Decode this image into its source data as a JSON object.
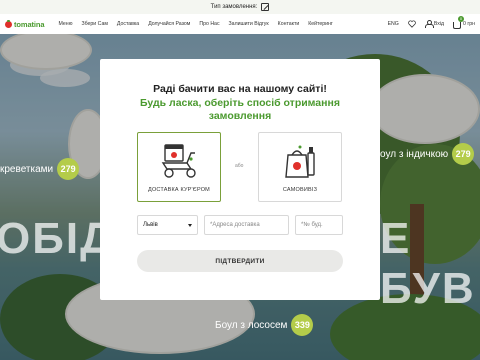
{
  "topbar": {
    "label": "Тип замовлення:"
  },
  "nav": {
    "logo": "tomatina",
    "menu": [
      "Меню",
      "Збери Сам",
      "Доставка",
      "Долучайся Разом",
      "Про Нас",
      "Залишити Відгук",
      "Контакти",
      "Кейтеринг"
    ],
    "lang": "ENG",
    "login": "Вхід",
    "cart_count": "0",
    "cart_price": "0 грн"
  },
  "hero": {
    "big_left": "ОБІД",
    "big_right": "Е БУВ",
    "items": [
      {
        "name": "креветками",
        "price": "279"
      },
      {
        "name": "оул з індичкою",
        "price": "279"
      },
      {
        "name": "Боул з лососем",
        "price": "339"
      }
    ]
  },
  "modal": {
    "title": "Раді бачити вас на нашому сайті!",
    "subtitle": "Будь ласка, оберіть спосіб отримання замовлення",
    "or": "або",
    "options": [
      {
        "label": "ДОСТАВКА КУР'ЄРОМ",
        "icon": "delivery-scooter-icon",
        "selected": true
      },
      {
        "label": "САМОВИВІЗ",
        "icon": "takeaway-bag-icon",
        "selected": false
      }
    ],
    "city": "Львів",
    "address_placeholder": "*Адреса доставка",
    "building_placeholder": "*№ буд.",
    "confirm_label": "ПІДТВЕРДИТИ"
  },
  "colors": {
    "accent": "#4b9a2f",
    "brand_red": "#e0302b",
    "price_badge": "#b4cc4a"
  }
}
